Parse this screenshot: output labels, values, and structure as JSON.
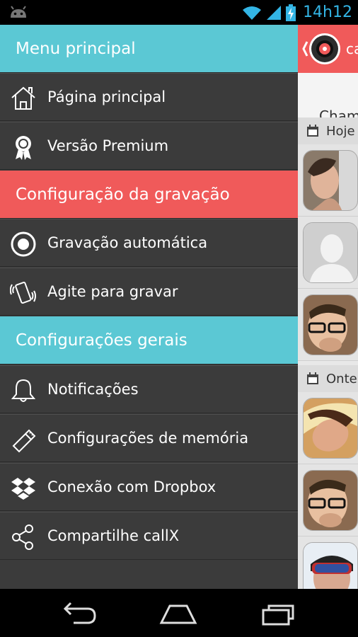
{
  "status": {
    "time": "14h12"
  },
  "drawer": {
    "header_main": "Menu principal",
    "items_main": [
      {
        "label": "Página principal",
        "icon": "home-icon"
      },
      {
        "label": "Versão Premium",
        "icon": "award-ribbon-icon"
      }
    ],
    "header_record": "Configuração da gravação",
    "items_record": [
      {
        "label": "Gravação automática",
        "icon": "radio-record-icon"
      },
      {
        "label": "Agite para gravar",
        "icon": "shake-phone-icon"
      }
    ],
    "header_general": "Configurações gerais",
    "items_general": [
      {
        "label": "Notificações",
        "icon": "bell-icon"
      },
      {
        "label": "Configurações de memória",
        "icon": "usb-memory-icon"
      },
      {
        "label": "Conexão com Dropbox",
        "icon": "dropbox-icon"
      },
      {
        "label": "Compartilhe callX",
        "icon": "share-icon"
      }
    ]
  },
  "content": {
    "header_text": "ca",
    "tab_label": "Cham",
    "date_today": "Hoje",
    "date_yesterday": "Onte"
  },
  "colors": {
    "teal": "#5bc8d4",
    "red": "#f05a5a",
    "drawer_bg": "#3b3b3b",
    "clock": "#33b5e5"
  }
}
